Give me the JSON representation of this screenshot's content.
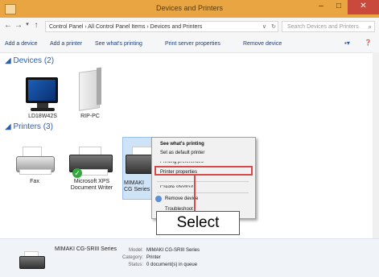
{
  "window": {
    "title": "Devices and Printers",
    "minimize_glyph": "–",
    "maximize_glyph": "□",
    "close_glyph": "✕"
  },
  "address": {
    "back_glyph": "←",
    "forward_glyph": "→",
    "recent_glyph": "▾",
    "up_glyph": "↑",
    "path": "Control Panel  ›  All Control Panel Items  ›  Devices and Printers",
    "dropdown_glyph": "∨",
    "refresh_glyph": "↻",
    "search_placeholder": "Search Devices and Printers",
    "search_icon": "⌕"
  },
  "toolbar": {
    "add_device": "Add a device",
    "add_printer": "Add a printer",
    "see_printing": "See what's printing",
    "print_server": "Print server properties",
    "remove_device": "Remove device",
    "view_glyph": "▪▾",
    "help_glyph": "❓"
  },
  "groups": {
    "devices": "◢ Devices (2)",
    "printers": "◢ Printers (3)"
  },
  "devices": [
    {
      "label": "LD18W42S"
    },
    {
      "label": "RIP-PC"
    }
  ],
  "printers": [
    {
      "label": "Fax"
    },
    {
      "label": "Microsoft XPS Document Writer"
    },
    {
      "label": "MIMAKI CG Series"
    }
  ],
  "context_menu": {
    "items": [
      "See what's printing",
      "Set as default printer",
      "Printing preferences",
      "Printer properties",
      "Create shortcut",
      "Remove device",
      "Troubleshoot"
    ]
  },
  "callout": {
    "text": "Select"
  },
  "details": {
    "name": "MIMAKI CG-SRIII Series",
    "model_key": "Model:",
    "model_val": "MIMAKI CG-SRIII Series",
    "category_key": "Category:",
    "category_val": "Printer",
    "status_key": "Status:",
    "status_val": "0 document(s) in queue"
  }
}
